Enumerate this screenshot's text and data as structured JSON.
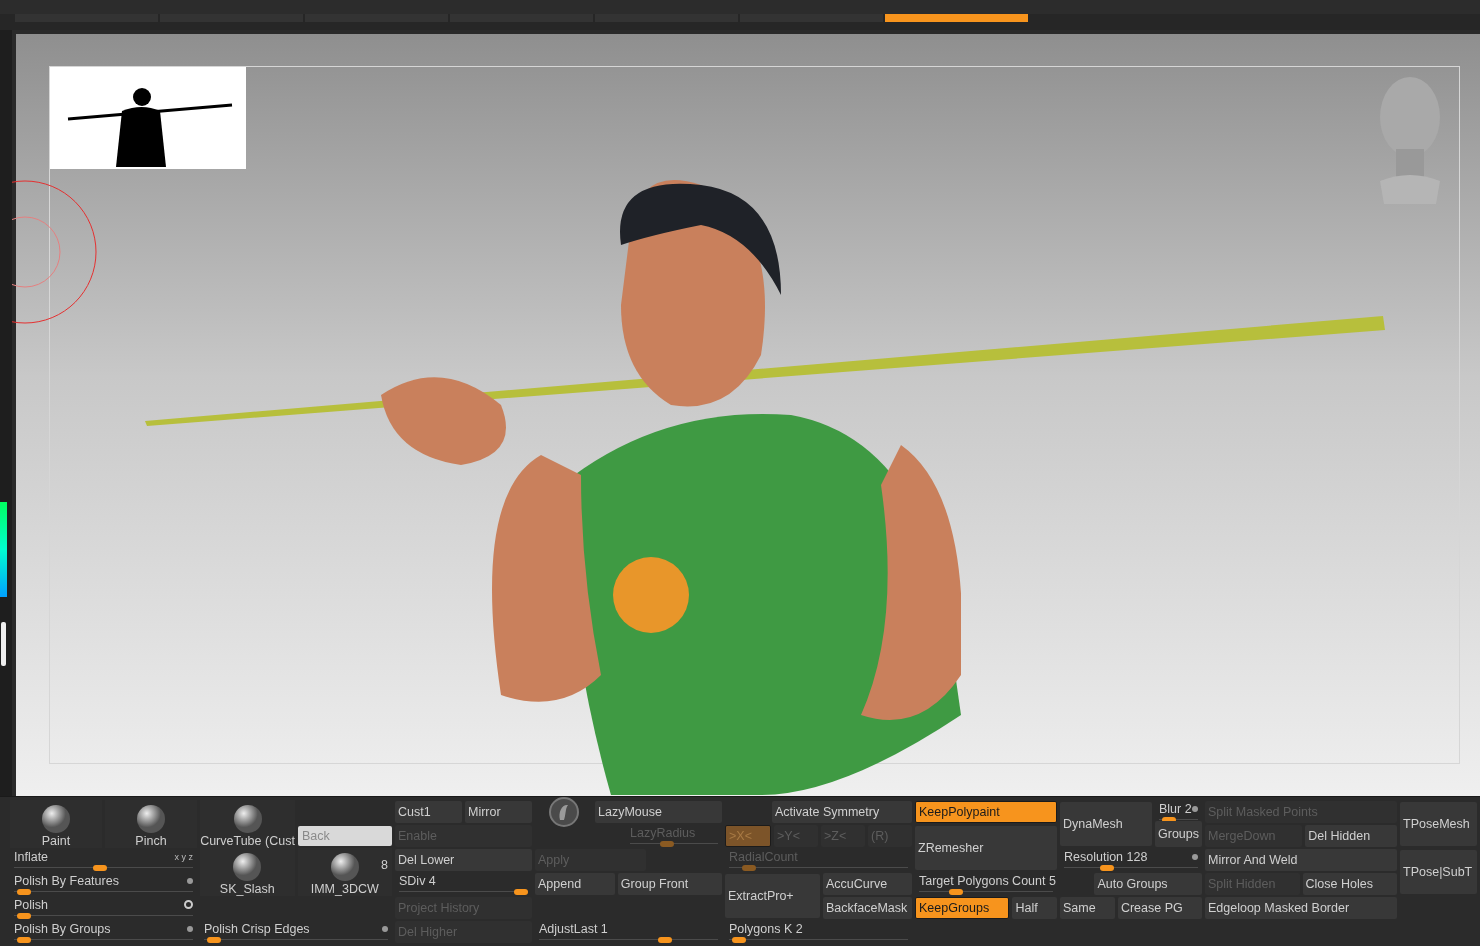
{
  "top_tabs": [
    {
      "selected": false
    },
    {
      "selected": false
    },
    {
      "selected": false
    },
    {
      "selected": false
    },
    {
      "selected": false
    },
    {
      "selected": false
    },
    {
      "selected": true
    }
  ],
  "panel": {
    "columns": [
      {
        "rows": [
          [
            {
              "kind": "tile",
              "label": "Paint"
            },
            {
              "kind": "tile",
              "label": "Pinch"
            }
          ],
          [
            {
              "kind": "slider",
              "label": "Inflate",
              "level": 0.48,
              "axes": "x y z"
            }
          ],
          [
            {
              "kind": "slider",
              "label": "Polish By Features",
              "level": 0.02,
              "toggle_on": false
            }
          ],
          [
            {
              "kind": "slider",
              "label": "Polish",
              "level": 0.02,
              "toggle_on": true
            }
          ],
          [
            {
              "kind": "slider",
              "label": "Polish By Groups",
              "level": 0.02,
              "toggle_on": false
            }
          ]
        ]
      },
      {
        "rows": [
          [
            {
              "kind": "tile",
              "label": "CurveTube (Cust"
            },
            {
              "kind": "field",
              "placeholder": "Back"
            }
          ],
          [
            {
              "kind": "tile",
              "label": "SK_Slash"
            },
            {
              "kind": "tile",
              "label": "IMM_3DCW",
              "badge": "8"
            }
          ],
          [
            {
              "kind": "gap"
            }
          ],
          [
            {
              "kind": "slider",
              "label": "Polish Crisp Edges",
              "level": 0.02,
              "toggle_on": false
            }
          ]
        ]
      },
      {
        "rows": [
          [
            {
              "kind": "button",
              "label": "Cust1",
              "on": false,
              "disabled": false
            },
            {
              "kind": "button",
              "label": "Mirror",
              "on": false,
              "disabled": false
            }
          ],
          [
            {
              "kind": "button",
              "label": "Enable",
              "on": false,
              "disabled": true
            }
          ],
          [
            {
              "kind": "button",
              "label": "Del Lower",
              "on": false,
              "disabled": false
            }
          ],
          [
            {
              "kind": "slider",
              "label": "SDiv 4",
              "level": 1
            }
          ],
          [
            {
              "kind": "button",
              "label": "Project History",
              "on": false,
              "disabled": true
            }
          ],
          [
            {
              "kind": "button",
              "label": "Del Higher",
              "on": false,
              "disabled": true
            }
          ]
        ]
      },
      {
        "rows": [
          [
            {
              "kind": "icon"
            },
            {
              "kind": "button",
              "label": "LazyMouse",
              "on": false,
              "disabled": false
            }
          ],
          [
            {
              "kind": "gap"
            },
            {
              "kind": "slider",
              "label": "LazyRadius",
              "level": 0.4,
              "disabled": true
            }
          ],
          [
            {
              "kind": "button",
              "label": "Apply",
              "on": false,
              "disabled": true
            },
            {
              "kind": "gap"
            }
          ],
          [
            {
              "kind": "button",
              "label": "Append",
              "on": false,
              "disabled": false
            },
            {
              "kind": "button",
              "label": "Group Front",
              "on": false,
              "disabled": false
            }
          ],
          [
            {
              "kind": "gap"
            }
          ],
          [
            {
              "kind": "slider",
              "label": "AdjustLast 1",
              "level": 0.72
            }
          ]
        ]
      },
      {
        "rows": [
          [
            {
              "kind": "gap"
            },
            {
              "kind": "button",
              "label": "Activate Symmetry",
              "on": false,
              "disabled": false
            }
          ],
          [
            {
              "kind": "button",
              "label": ">X<",
              "on": true,
              "disabled": true
            },
            {
              "kind": "button",
              "label": ">Y<",
              "on": false,
              "disabled": true
            },
            {
              "kind": "button",
              "label": ">Z<",
              "on": false,
              "disabled": true
            },
            {
              "kind": "button",
              "label": "(R)",
              "on": false,
              "disabled": true
            }
          ],
          [
            {
              "kind": "slider",
              "label": "RadialCount",
              "level": 0.08,
              "disabled": true
            }
          ],
          [
            {
              "kind": "big_button",
              "label": "ExtractPro+",
              "on": false,
              "disabled": false
            },
            {
              "kind": "stack",
              "items": [
                {
                  "kind": "button",
                  "label": "AccuCurve",
                  "on": false,
                  "disabled": false
                },
                {
                  "kind": "button",
                  "label": "BackfaceMask",
                  "on": false,
                  "disabled": false
                }
              ]
            }
          ],
          [
            {
              "kind": "slider",
              "label": "Polygons K 2",
              "level": 0.02
            }
          ]
        ]
      },
      {
        "rows": [
          [
            {
              "kind": "button",
              "label": "KeepPolypaint",
              "on": true,
              "disabled": false
            }
          ],
          [
            {
              "kind": "big_button",
              "label": "ZRemesher",
              "on": false,
              "disabled": false
            }
          ],
          [
            {
              "kind": "slider",
              "label": "Target Polygons Count 5",
              "level": 0.25
            }
          ],
          [
            {
              "kind": "button",
              "label": "KeepGroups",
              "on": true,
              "disabled": false
            },
            {
              "kind": "button",
              "label": "Half",
              "on": false,
              "disabled": false
            }
          ]
        ]
      },
      {
        "rows": [
          [
            {
              "kind": "big_button",
              "label": "DynaMesh",
              "on": false,
              "disabled": false
            },
            {
              "kind": "stack",
              "items": [
                {
                  "kind": "slider",
                  "label": "Blur 2",
                  "level": 0.12,
                  "toggle_on": false
                },
                {
                  "kind": "button",
                  "label": "Groups",
                  "on": false,
                  "disabled": false
                }
              ]
            }
          ],
          [
            {
              "kind": "slider",
              "label": "Resolution 128",
              "level": 0.3,
              "toggle_on": false
            }
          ],
          [
            {
              "kind": "gap"
            },
            {
              "kind": "button",
              "label": "Auto Groups",
              "on": false,
              "disabled": false
            }
          ],
          [
            {
              "kind": "button",
              "label": "Same",
              "on": false,
              "disabled": false
            },
            {
              "kind": "button",
              "label": "Crease PG",
              "on": false,
              "disabled": false
            }
          ]
        ]
      },
      {
        "rows": [
          [
            {
              "kind": "button",
              "label": "Split Masked Points",
              "on": false,
              "disabled": true
            }
          ],
          [
            {
              "kind": "button",
              "label": "MergeDown",
              "on": false,
              "disabled": true
            },
            {
              "kind": "button",
              "label": "Del Hidden",
              "on": false,
              "disabled": false
            }
          ],
          [
            {
              "kind": "button",
              "label": "Mirror And Weld",
              "on": false,
              "disabled": false
            }
          ],
          [
            {
              "kind": "button",
              "label": "Split Hidden",
              "on": false,
              "disabled": true
            },
            {
              "kind": "button",
              "label": "Close Holes",
              "on": false,
              "disabled": false
            }
          ],
          [
            {
              "kind": "button",
              "label": "Edgeloop Masked Border",
              "on": false,
              "disabled": false
            }
          ]
        ]
      },
      {
        "rows": [
          [
            {
              "kind": "big_button",
              "label": "TPoseMesh",
              "on": false,
              "disabled": false
            }
          ],
          [
            {
              "kind": "big_button",
              "label": "TPose|SubT",
              "on": false,
              "disabled": false
            }
          ]
        ]
      }
    ]
  }
}
